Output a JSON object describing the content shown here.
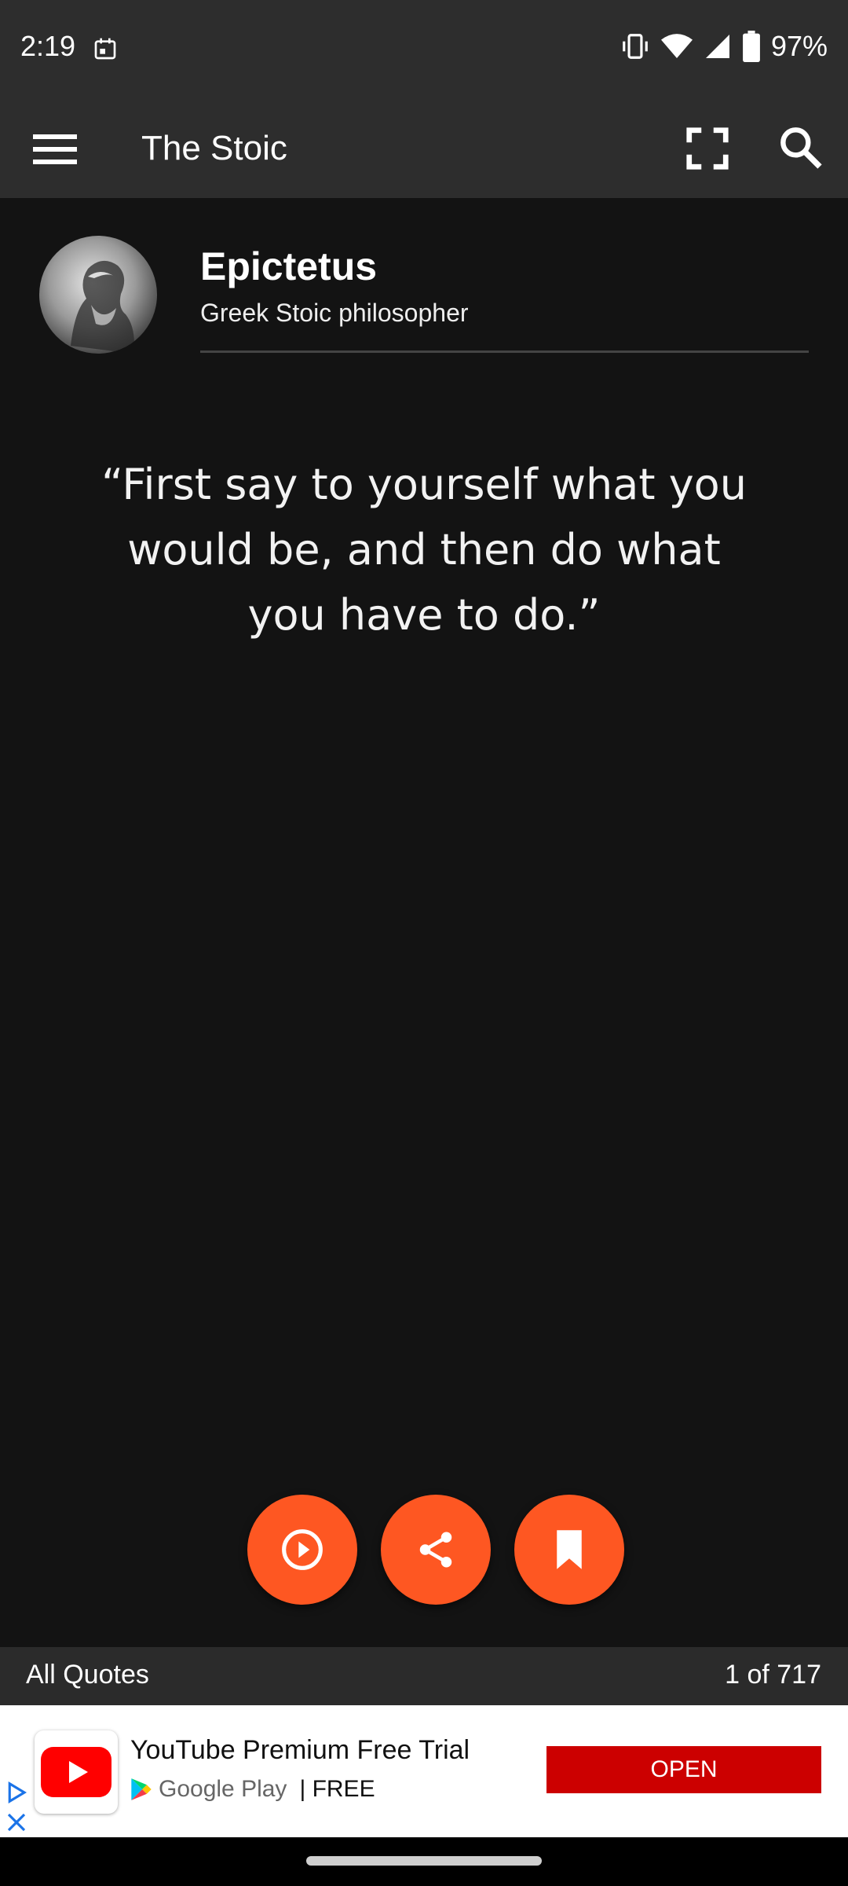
{
  "status_bar": {
    "time": "2:19",
    "battery": "97%",
    "icons": [
      "calendar-icon",
      "vibrate-icon",
      "wifi-icon",
      "signal-icon",
      "battery-icon"
    ]
  },
  "app_bar": {
    "title": "The Stoic",
    "icons": [
      "menu-icon",
      "fullscreen-icon",
      "search-icon"
    ]
  },
  "author": {
    "name": "Epictetus",
    "description": "Greek Stoic philosopher"
  },
  "quote": {
    "text": "“First say to yourself what you would be, and then do what you have to do.”"
  },
  "actions": {
    "icons": [
      "play-icon",
      "share-icon",
      "bookmark-icon"
    ],
    "accent_color": "#fe5722"
  },
  "footer": {
    "category": "All Quotes",
    "position": "1 of 717"
  },
  "ad": {
    "title": "YouTube Premium Free Trial",
    "store": "Google Play",
    "price": "| FREE",
    "cta": "OPEN",
    "cta_color": "#cc0000"
  }
}
